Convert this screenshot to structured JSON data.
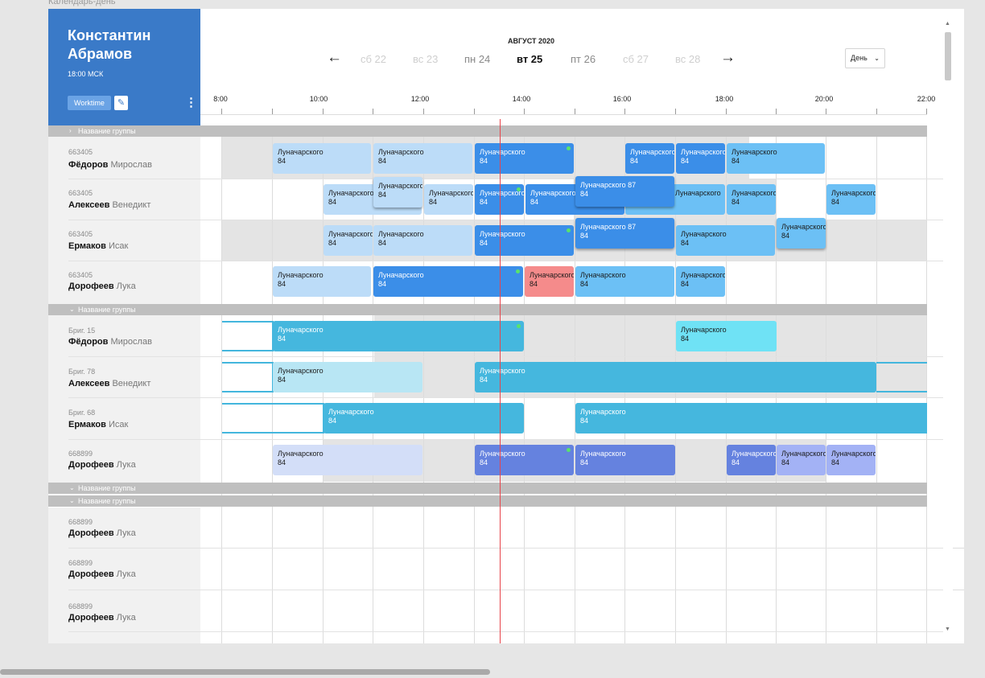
{
  "frame_title": "Календарь-день",
  "user": {
    "name": "Константин Абрамов",
    "time": "18:00 МСК",
    "worktime_label": "Worktime",
    "edit_icon": "pencil-icon",
    "more_icon": "more-vertical-icon"
  },
  "nav": {
    "month": "АВГУСТ 2020",
    "prev_icon": "←",
    "next_icon": "→",
    "days": [
      "сб 22",
      "вс 23",
      "пн 24",
      "вт 25",
      "пт 26",
      "сб 27",
      "вс 28"
    ],
    "current_day": "вт 25",
    "view_value": "День",
    "view_chevron": "⌄"
  },
  "timeline": {
    "labels": [
      "8:00",
      "10:00",
      "12:00",
      "14:00",
      "16:00",
      "18:00",
      "20:00",
      "22:00"
    ]
  },
  "groups": [
    {
      "label": "Название группы",
      "chevron": "›",
      "state": "collapsed-icon"
    },
    {
      "label": "Название группы",
      "chevron": "⌄",
      "state": "expanded-icon"
    },
    {
      "label": "Название группы",
      "chevron": "⌄",
      "state": "expanded-icon"
    },
    {
      "label": "Название группы",
      "chevron": "⌄",
      "state": "expanded-icon"
    }
  ],
  "rows": [
    {
      "id": "663405",
      "surname": "Фёдоров",
      "first": "Мирослав"
    },
    {
      "id": "663405",
      "surname": "Алексеев",
      "first": "Венедикт"
    },
    {
      "id": "663405",
      "surname": "Ермаков",
      "first": "Исак"
    },
    {
      "id": "663405",
      "surname": "Дорофеев",
      "first": "Лука"
    },
    {
      "id": "Бриг. 15",
      "surname": "Фёдоров",
      "first": "Мирослав"
    },
    {
      "id": "Бриг. 78",
      "surname": "Алексеев",
      "first": "Венедикт"
    },
    {
      "id": "Бриг. 68",
      "surname": "Ермаков",
      "first": "Исак"
    },
    {
      "id": "668899",
      "surname": "Дорофеев",
      "first": "Лука"
    },
    {
      "id": "668899",
      "surname": "Дорофеев",
      "first": "Лука"
    },
    {
      "id": "668899",
      "surname": "Дорофеев",
      "first": "Лука"
    },
    {
      "id": "668899",
      "surname": "Дорофеев",
      "first": "Лука"
    }
  ],
  "event": {
    "street": "Луначарского",
    "number": "84",
    "alt_title": "Луначарского 87",
    "alt_number": "84"
  },
  "colors": {
    "header_blue": "#3a7ac8",
    "event_light": "#bcdcf8",
    "event_blue": "#3b8ee8",
    "event_sky": "#6cc0f5",
    "event_red": "#f58b8b",
    "event_teal": "#45b7de",
    "event_cyan": "#6fe2f5",
    "event_pale": "#b8e6f4",
    "event_indigo": "#6582df",
    "event_lavender": "#a3b2f5",
    "event_periwinkle": "#d3def8",
    "now_line": "#e8444b",
    "status_dot": "#59e36b"
  }
}
